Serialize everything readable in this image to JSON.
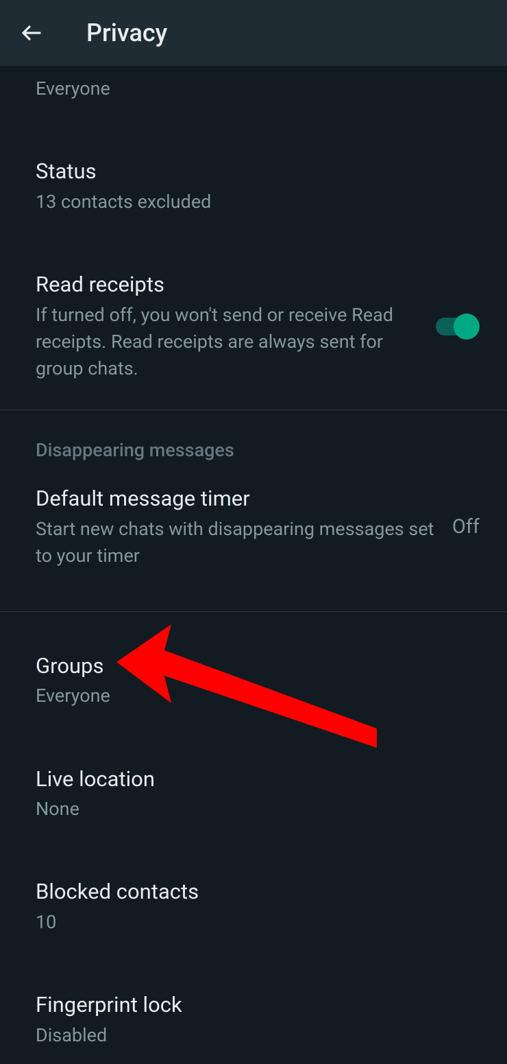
{
  "header": {
    "title": "Privacy"
  },
  "items": {
    "prev_partial_sub": "Everyone",
    "status": {
      "title": "Status",
      "sub": "13 contacts excluded"
    },
    "read_receipts": {
      "title": "Read receipts",
      "sub": "If turned off, you won't send or receive Read receipts. Read receipts are always sent for group chats.",
      "toggle_on": true
    },
    "section_disappearing": "Disappearing messages",
    "default_timer": {
      "title": "Default message timer",
      "sub": "Start new chats with disappearing messages set to your timer",
      "value": "Off"
    },
    "groups": {
      "title": "Groups",
      "sub": "Everyone"
    },
    "live_location": {
      "title": "Live location",
      "sub": "None"
    },
    "blocked": {
      "title": "Blocked contacts",
      "sub": "10"
    },
    "fingerprint": {
      "title": "Fingerprint lock",
      "sub": "Disabled"
    }
  }
}
